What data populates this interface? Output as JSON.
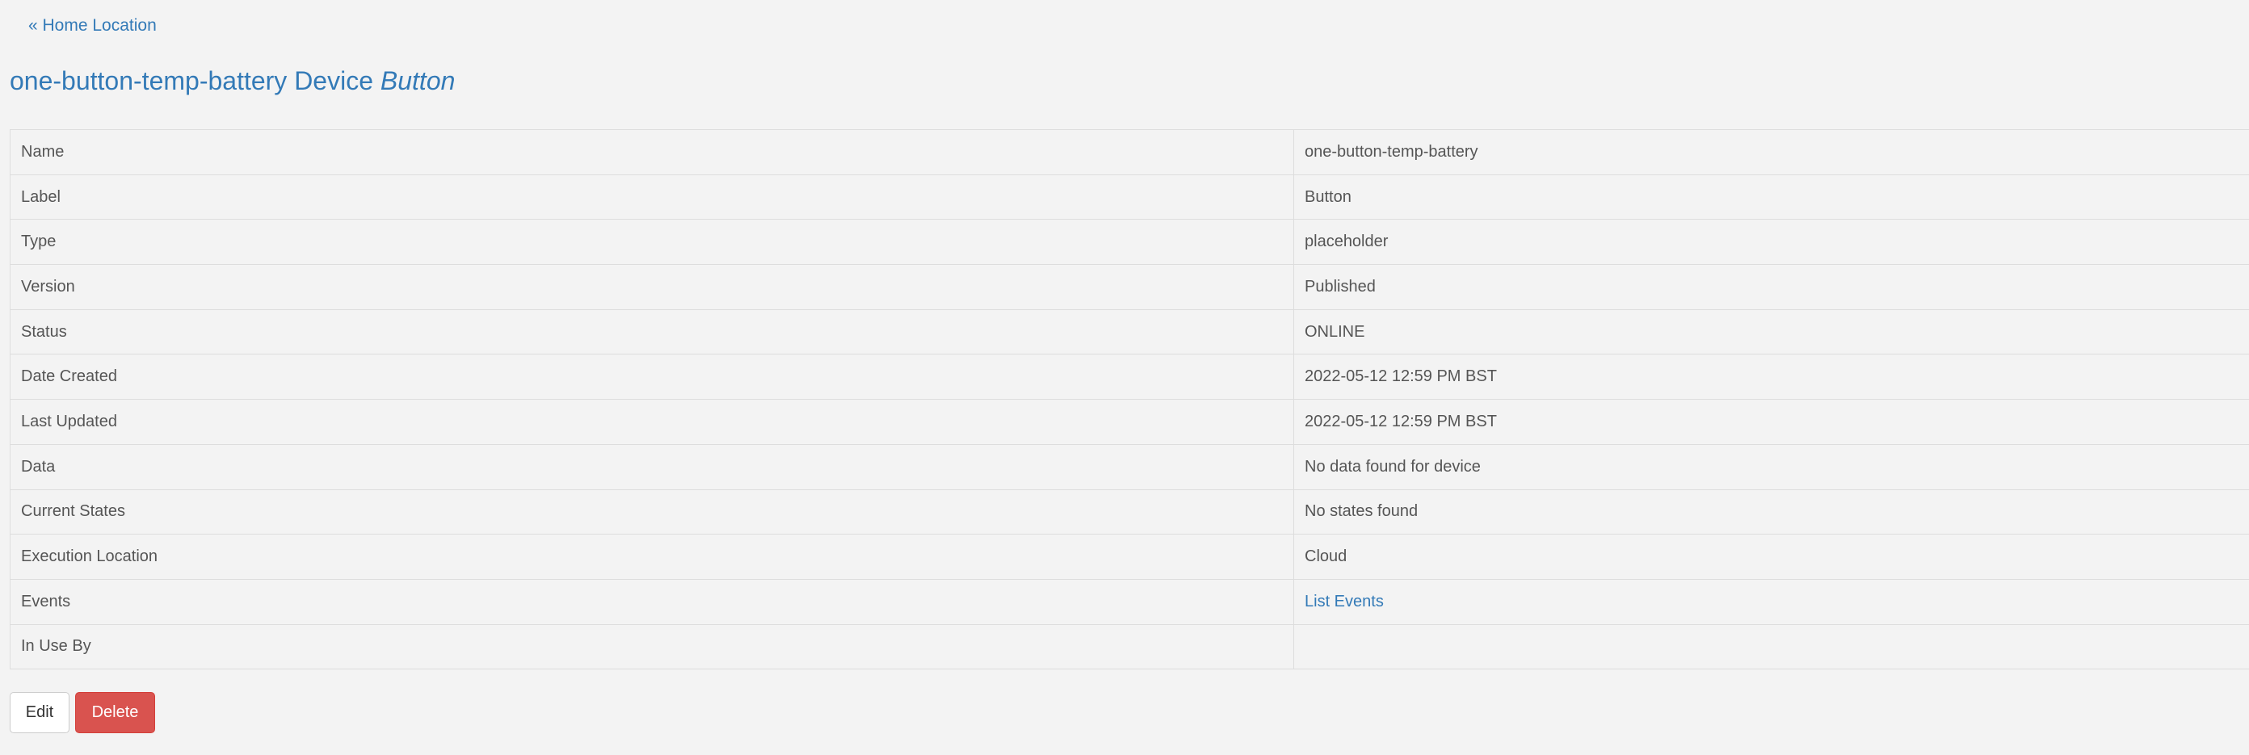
{
  "nav": {
    "back_label": "« Home Location"
  },
  "header": {
    "title_main": "one-button-temp-battery Device",
    "title_label": "Button"
  },
  "details": {
    "rows": [
      {
        "key": "Name",
        "value": "one-button-temp-battery"
      },
      {
        "key": "Label",
        "value": "Button"
      },
      {
        "key": "Type",
        "value": "placeholder"
      },
      {
        "key": "Version",
        "value": "Published"
      },
      {
        "key": "Status",
        "value": "ONLINE"
      },
      {
        "key": "Date Created",
        "value": "2022-05-12 12:59 PM BST"
      },
      {
        "key": "Last Updated",
        "value": "2022-05-12 12:59 PM BST"
      },
      {
        "key": "Data",
        "value": "No data found for device"
      },
      {
        "key": "Current States",
        "value": "No states found"
      },
      {
        "key": "Execution Location",
        "value": "Cloud"
      },
      {
        "key": "Events",
        "value": "List Events"
      },
      {
        "key": "In Use By",
        "value": ""
      }
    ]
  },
  "actions": {
    "edit_label": "Edit",
    "delete_label": "Delete"
  },
  "colors": {
    "link": "#337ab7",
    "danger": "#d9534f",
    "background": "#f3f3f3"
  }
}
